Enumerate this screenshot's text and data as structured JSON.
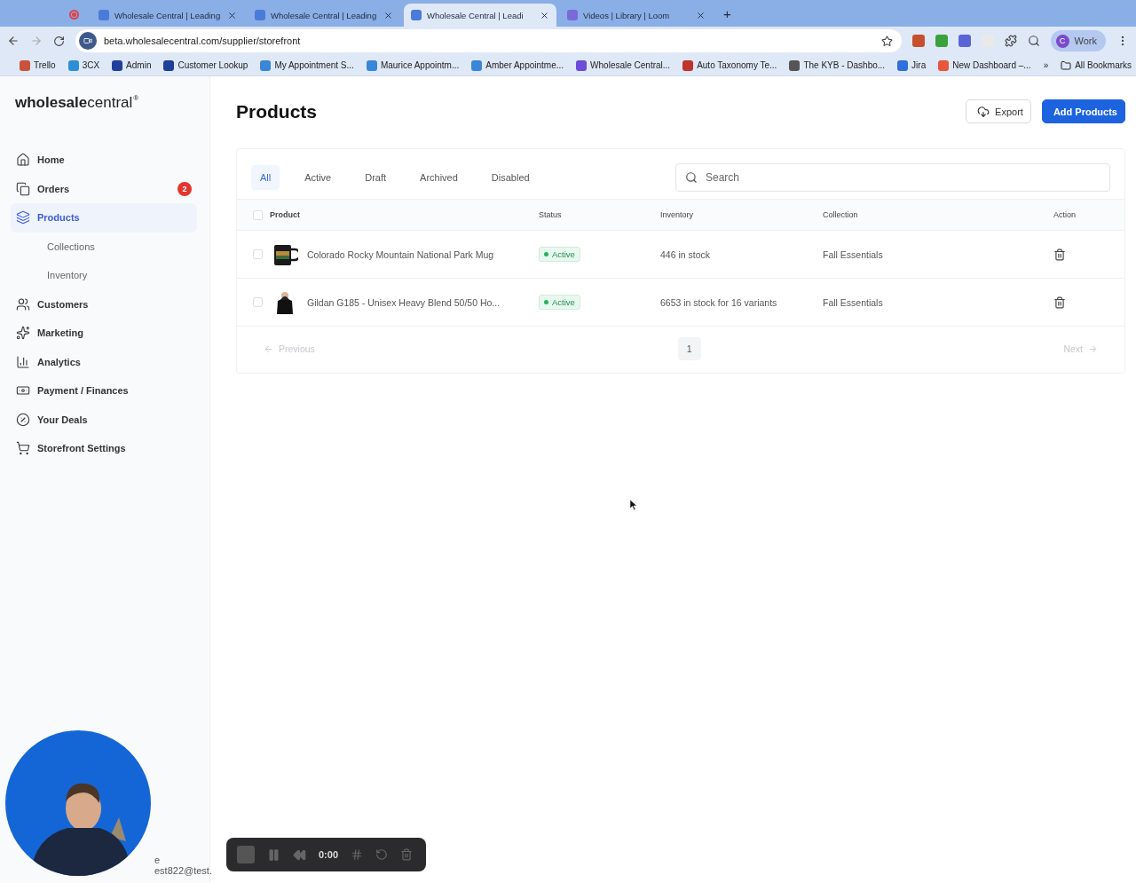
{
  "browser": {
    "tabs": [
      {
        "title": "Wholesale Central | Leading",
        "selected": false
      },
      {
        "title": "Wholesale Central | Leading",
        "selected": false
      },
      {
        "title": "Wholesale Central | Leadi",
        "selected": true
      },
      {
        "title": "Videos | Library | Loom",
        "selected": false
      }
    ],
    "new_tab": "+",
    "url": "beta.wholesalecentral.com/supplier/storefront",
    "profile": {
      "initial": "C",
      "label": "Work"
    },
    "bookmarks": [
      "Trello",
      "3CX",
      "Admin",
      "Customer Lookup",
      "My Appointment S...",
      "Maurice Appointm...",
      "Amber Appointme...",
      "Wholesale Central...",
      "Auto Taxonomy Te...",
      "The KYB - Dashbo...",
      "Jira",
      "New Dashboard –..."
    ],
    "more_bookmarks": "»",
    "all_bookmarks": "All Bookmarks"
  },
  "sidebar": {
    "logo": {
      "part_1": "wholesale",
      "part_2": "central",
      "mark": "®"
    },
    "items": [
      {
        "kind": "item",
        "label": "Home",
        "selected": false
      },
      {
        "kind": "item",
        "label": "Orders",
        "selected": false,
        "badge": "2"
      },
      {
        "kind": "item",
        "label": "Products",
        "selected": true
      },
      {
        "kind": "sub",
        "label": "Collections",
        "selected": false
      },
      {
        "kind": "sub",
        "label": "Inventory",
        "selected": false
      },
      {
        "kind": "item",
        "label": "Customers",
        "selected": false
      },
      {
        "kind": "item",
        "label": "Marketing",
        "selected": false
      },
      {
        "kind": "item",
        "label": "Analytics",
        "selected": false
      },
      {
        "kind": "item",
        "label": "Payment / Finances",
        "selected": false
      },
      {
        "kind": "item",
        "label": "Your Deals",
        "selected": false
      },
      {
        "kind": "item",
        "label": "Storefront Settings",
        "selected": false
      }
    ],
    "user": {
      "name": "e",
      "email": "est822@test."
    }
  },
  "page": {
    "title": "Products",
    "export_button": "Export",
    "add_button": "Add Products"
  },
  "filters": [
    {
      "label": "All",
      "selected": true
    },
    {
      "label": "Active",
      "selected": false
    },
    {
      "label": "Draft",
      "selected": false
    },
    {
      "label": "Archived",
      "selected": false
    },
    {
      "label": "Disabled",
      "selected": false
    }
  ],
  "search": {
    "placeholder": "Search"
  },
  "table": {
    "select_all_checked": false,
    "columns": [
      "Product",
      "Status",
      "Inventory",
      "Collection",
      "Action"
    ],
    "rows": [
      {
        "checked": false,
        "product": "Colorado Rocky Mountain National Park Mug",
        "status": "Active",
        "inventory": "446 in stock",
        "collection": "Fall Essentials"
      },
      {
        "checked": false,
        "product": "Gildan G185 - Unisex Heavy Blend 50/50 Ho...",
        "status": "Active",
        "inventory": "6653 in stock for 16 variants",
        "collection": "Fall Essentials"
      }
    ]
  },
  "pagination": {
    "previous": "Previous",
    "page": "1",
    "next": "Next"
  },
  "recorder": {
    "time": "0:00"
  }
}
